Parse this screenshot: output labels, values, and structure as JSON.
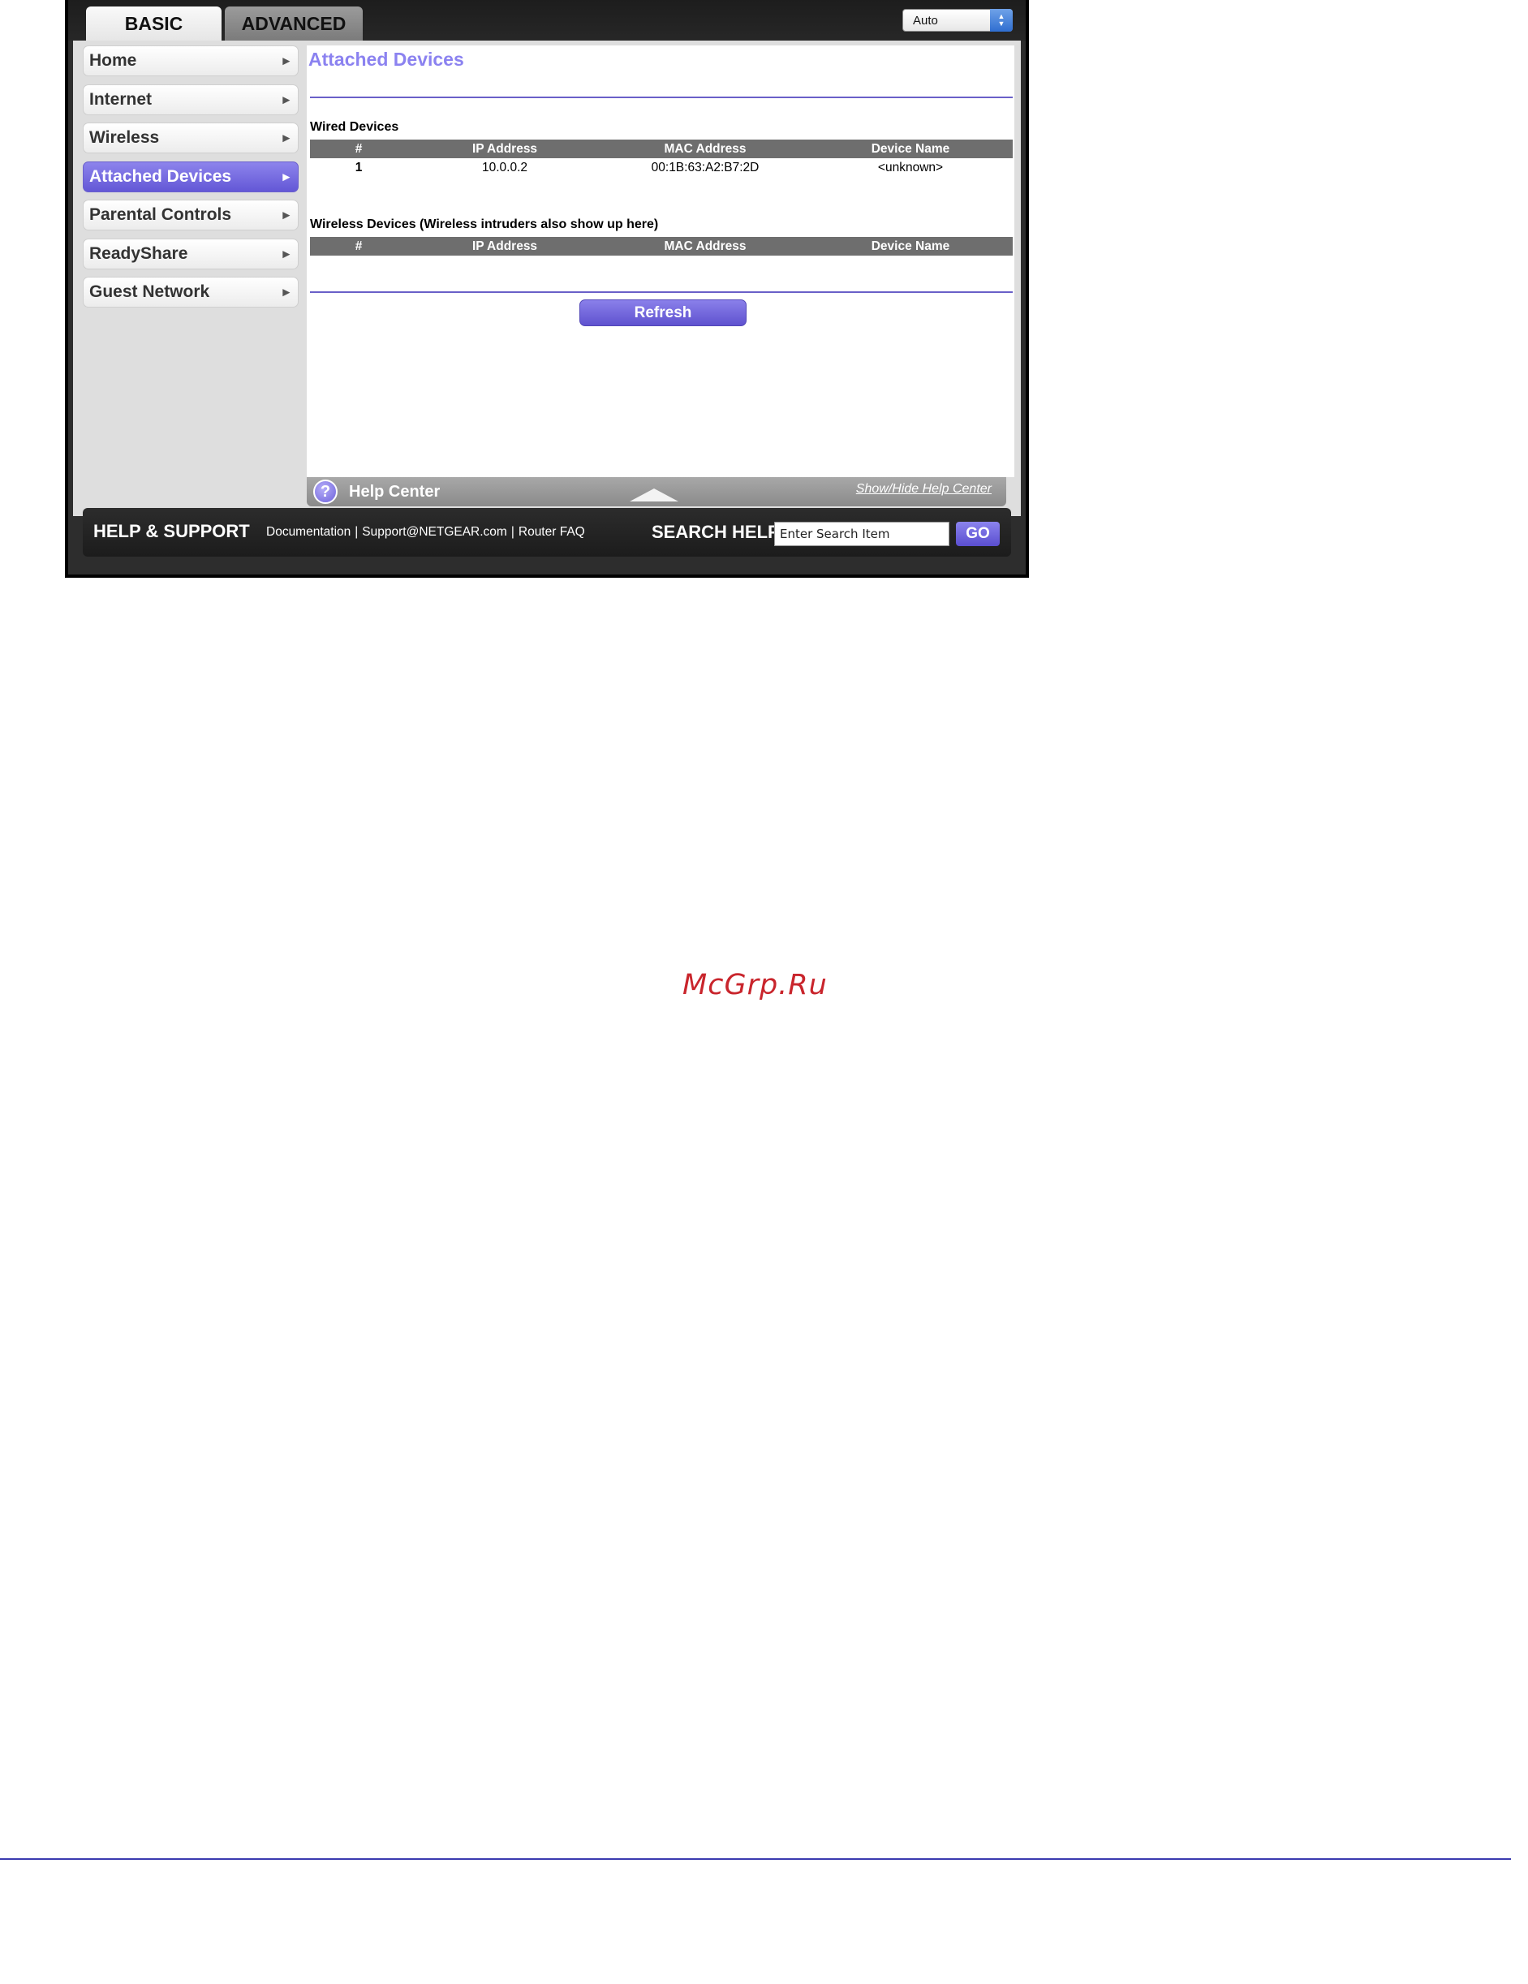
{
  "tabs": {
    "basic": "BASIC",
    "advanced": "ADVANCED"
  },
  "language_select": {
    "value": "Auto"
  },
  "sidebar": {
    "items": [
      {
        "label": "Home"
      },
      {
        "label": "Internet"
      },
      {
        "label": "Wireless"
      },
      {
        "label": "Attached Devices",
        "active": true
      },
      {
        "label": "Parental Controls"
      },
      {
        "label": "ReadyShare"
      },
      {
        "label": "Guest Network"
      }
    ]
  },
  "main": {
    "title": "Attached Devices",
    "wired": {
      "label": "Wired Devices",
      "columns": [
        "#",
        "IP Address",
        "MAC Address",
        "Device Name"
      ],
      "rows": [
        {
          "num": "1",
          "ip": "10.0.0.2",
          "mac": "00:1B:63:A2:B7:2D",
          "name": "<unknown>"
        }
      ]
    },
    "wireless": {
      "label": "Wireless Devices (Wireless intruders also show up here)",
      "columns": [
        "#",
        "IP Address",
        "MAC Address",
        "Device Name"
      ]
    },
    "refresh_label": "Refresh"
  },
  "help_center": {
    "label": "Help Center",
    "toggle_link": "Show/Hide Help Center",
    "icon": "question-icon"
  },
  "support": {
    "title": "HELP & SUPPORT",
    "links": [
      "Documentation",
      "Support@NETGEAR.com",
      "Router FAQ"
    ],
    "search_label": "SEARCH HELP",
    "search_placeholder": "Enter Search Item",
    "go_label": "GO"
  },
  "watermark": "McGrp.Ru",
  "colors": {
    "accent": "#6357d6",
    "title": "#8b82f0",
    "watermark": "#c9252c"
  }
}
